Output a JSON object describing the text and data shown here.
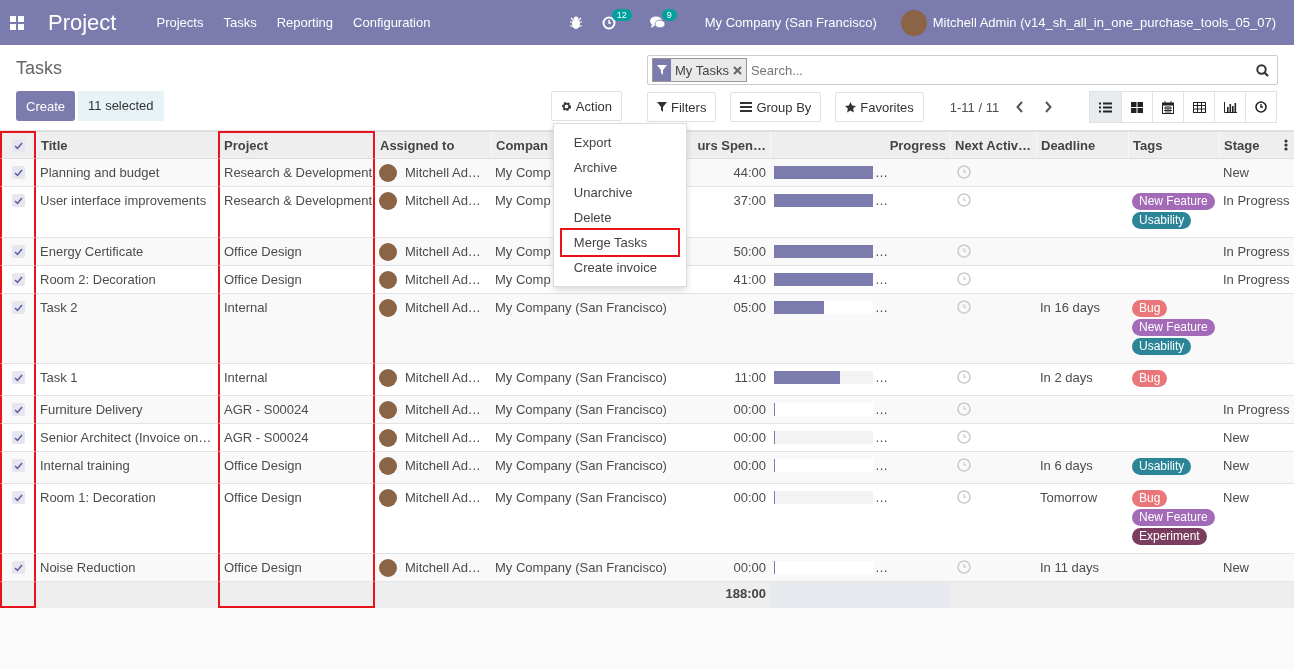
{
  "navbar": {
    "app_title": "Project",
    "menus": [
      "Projects",
      "Tasks",
      "Reporting",
      "Configuration"
    ],
    "activity_badge": "12",
    "messages_badge": "9",
    "company": "My Company (San Francisco)",
    "user": "Mitchell Admin (v14_sh_all_in_one_purchase_tools_05_07)"
  },
  "control_panel": {
    "breadcrumb": "Tasks",
    "create_label": "Create",
    "selected_label": "11 selected",
    "action_label": "Action",
    "action_menu": [
      {
        "label": "Export",
        "highlighted": false
      },
      {
        "label": "Archive",
        "highlighted": false
      },
      {
        "label": "Unarchive",
        "highlighted": false
      },
      {
        "label": "Delete",
        "highlighted": false
      },
      {
        "label": "Merge Tasks",
        "highlighted": true
      },
      {
        "label": "Create invoice",
        "highlighted": false
      }
    ],
    "search": {
      "facet": "My Tasks",
      "placeholder": "Search..."
    },
    "filters_label": "Filters",
    "group_by_label": "Group By",
    "favorites_label": "Favorites",
    "pager": "1-11 / 11",
    "views": [
      {
        "kind": "list",
        "selected": true
      },
      {
        "kind": "kanban",
        "selected": false
      },
      {
        "kind": "calendar",
        "selected": false
      },
      {
        "kind": "pivot",
        "selected": false
      },
      {
        "kind": "graph",
        "selected": false
      },
      {
        "kind": "activity",
        "selected": false
      }
    ]
  },
  "table": {
    "select_all": {
      "checked": true,
      "highlighted": true
    },
    "columns": [
      {
        "label": "Title",
        "highlighted": false
      },
      {
        "label": "Project",
        "highlighted": true
      },
      {
        "label": "Assigned to",
        "highlighted": false
      },
      {
        "label": "Compan",
        "highlighted": false
      },
      {
        "label": "urs Spen…",
        "highlighted": false
      },
      {
        "label": "Progress",
        "highlighted": false
      },
      {
        "label": "Next Activ…",
        "highlighted": false
      },
      {
        "label": "Deadline",
        "highlighted": false
      },
      {
        "label": "Tags",
        "highlighted": false
      },
      {
        "label": "Stage",
        "highlighted": false
      }
    ],
    "rows": [
      {
        "checked": true,
        "title": "Planning and budget",
        "project": "Research & Development",
        "assigned": "Mitchell Ad…",
        "company": "My Comp",
        "hours": "44:00",
        "level": 1,
        "progress_more": "…",
        "deadline": "",
        "tags": [],
        "stage": "New"
      },
      {
        "checked": true,
        "title": "User interface improvements",
        "project": "Research & Development",
        "assigned": "Mitchell Ad…",
        "company": "My Comp",
        "hours": "37:00",
        "level": 1,
        "progress_more": "…",
        "deadline": "",
        "tags": [
          {
            "label": "New Feature",
            "color": "#a36ab8"
          },
          {
            "label": "Usability",
            "color": "#2b8597"
          }
        ],
        "stage": "In Progress"
      },
      {
        "checked": true,
        "title": "Energy Certificate",
        "project": "Office Design",
        "assigned": "Mitchell Ad…",
        "company": "My Comp",
        "hours": "50:00",
        "level": 1,
        "progress_more": "…",
        "deadline": "",
        "tags": [],
        "stage": "In Progress"
      },
      {
        "checked": true,
        "title": "Room 2: Decoration",
        "project": "Office Design",
        "assigned": "Mitchell Ad…",
        "company": "My Comp",
        "hours": "41:00",
        "level": 1,
        "progress_more": "…",
        "deadline": "",
        "tags": [],
        "stage": "In Progress"
      },
      {
        "checked": true,
        "title": "Task 2",
        "project": "Internal",
        "assigned": "Mitchell Ad…",
        "company": "My Company (San Francisco)",
        "hours": "05:00",
        "level": 0.5,
        "progress_more": "…",
        "deadline": "In 16 days",
        "tags": [
          {
            "label": "Bug",
            "color": "#e9777a"
          },
          {
            "label": "New Feature",
            "color": "#a36ab8"
          },
          {
            "label": "Usability",
            "color": "#2b8597"
          }
        ],
        "stage": ""
      },
      {
        "checked": true,
        "title": "Task 1",
        "project": "Internal",
        "assigned": "Mitchell Ad…",
        "company": "My Company (San Francisco)",
        "hours": "11:00",
        "level": 0.67,
        "progress_more": "…",
        "deadline": "In 2 days",
        "tags": [
          {
            "label": "Bug",
            "color": "#e9777a"
          }
        ],
        "stage": ""
      },
      {
        "checked": true,
        "title": "Furniture Delivery",
        "project": "AGR - S00024",
        "assigned": "Mitchell Ad…",
        "company": "My Company (San Francisco)",
        "hours": "00:00",
        "level": 0,
        "progress_more": "…",
        "deadline": "",
        "tags": [],
        "stage": "In Progress"
      },
      {
        "checked": true,
        "title": "Senior Architect (Invoice on…",
        "project": "AGR - S00024",
        "assigned": "Mitchell Ad…",
        "company": "My Company (San Francisco)",
        "hours": "00:00",
        "level": 0,
        "progress_more": "…",
        "deadline": "",
        "tags": [],
        "stage": "New"
      },
      {
        "checked": true,
        "title": "Internal training",
        "project": "Office Design",
        "assigned": "Mitchell Ad…",
        "company": "My Company (San Francisco)",
        "hours": "00:00",
        "level": 0,
        "progress_more": "…",
        "deadline": "In 6 days",
        "tags": [
          {
            "label": "Usability",
            "color": "#2b8597"
          }
        ],
        "stage": "New"
      },
      {
        "checked": true,
        "title": "Room 1: Decoration",
        "project": "Office Design",
        "assigned": "Mitchell Ad…",
        "company": "My Company (San Francisco)",
        "hours": "00:00",
        "level": 0,
        "progress_more": "…",
        "deadline": "Tomorrow",
        "tags": [
          {
            "label": "Bug",
            "color": "#e9777a"
          },
          {
            "label": "New Feature",
            "color": "#a36ab8"
          },
          {
            "label": "Experiment",
            "color": "#7a3d5f"
          }
        ],
        "stage": "New"
      },
      {
        "checked": true,
        "title": "Noise Reduction",
        "project": "Office Design",
        "assigned": "Mitchell Ad…",
        "company": "My Company (San Francisco)",
        "hours": "00:00",
        "level": 0,
        "progress_more": "…",
        "deadline": "In 11 days",
        "tags": [],
        "stage": "New"
      }
    ],
    "footer": {
      "hours_total": "188:00"
    }
  }
}
